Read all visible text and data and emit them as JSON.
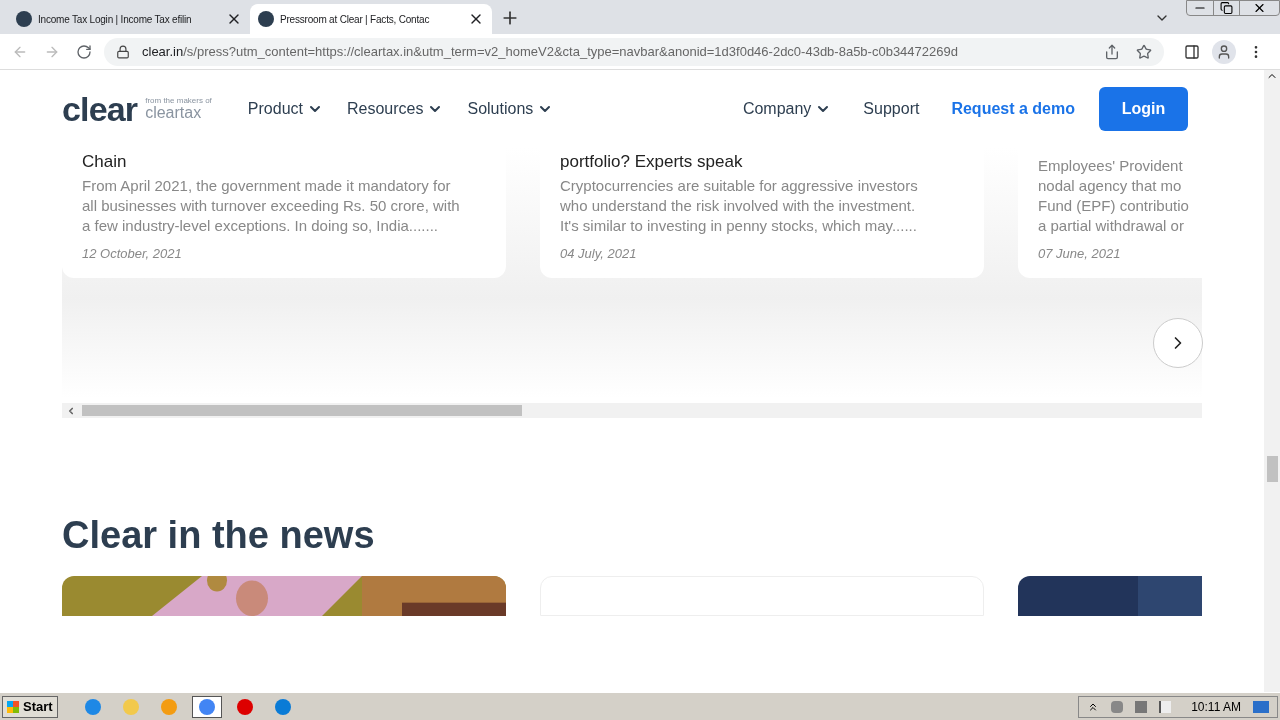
{
  "browser": {
    "tabs": [
      {
        "title": "Income Tax Login | Income Tax efilin",
        "selected": false
      },
      {
        "title": "Pressroom at Clear | Facts, Contac",
        "selected": true
      }
    ],
    "url": {
      "host": "clear.in",
      "path": "/s/press?utm_content=https://cleartax.in&utm_term=v2_homeV2&cta_type=navbar&anonid=1d3f0d46-2dc0-43db-8a5b-c0b34472269d"
    }
  },
  "site_header": {
    "logo": "clear",
    "logo_tagline": "from the makers of",
    "logo_sub": "cleartax",
    "nav_left": [
      {
        "label": "Product",
        "dropdown": true
      },
      {
        "label": "Resources",
        "dropdown": true
      },
      {
        "label": "Solutions",
        "dropdown": true
      }
    ],
    "nav_right": [
      {
        "label": "Company",
        "dropdown": true
      },
      {
        "label": "Support",
        "dropdown": false
      }
    ],
    "demo_link": "Request a demo",
    "login_button": "Login"
  },
  "articles": [
    {
      "title": "Chain",
      "lines": [
        "From April 2021, the government made it mandatory for",
        "all businesses with turnover exceeding Rs. 50 crore, with",
        "a few industry-level exceptions. In doing so, India......."
      ],
      "date": "12 October, 2021"
    },
    {
      "title": "portfolio? Experts speak",
      "lines": [
        "Cryptocurrencies are suitable for aggressive investors",
        "who understand the risk involved with the investment.",
        "It's similar to investing in penny stocks, which may......"
      ],
      "date": "04 July, 2021"
    },
    {
      "lines": [
        "Employees' Provident",
        "nodal agency that mo",
        "Fund (EPF) contributio",
        "a partial withdrawal or"
      ],
      "date": "07 June, 2021"
    }
  ],
  "news": {
    "heading": "Clear in the news",
    "cards": [
      {
        "kind": "picture"
      },
      {
        "kind": "blank"
      },
      {
        "kind": "picture"
      }
    ]
  },
  "taskbar": {
    "start": "Start",
    "apps": [
      {
        "selected": false
      },
      {
        "selected": false
      },
      {
        "selected": false
      },
      {
        "selected": true
      },
      {
        "selected": false
      },
      {
        "selected": false
      }
    ],
    "time": "10:11 AM"
  }
}
